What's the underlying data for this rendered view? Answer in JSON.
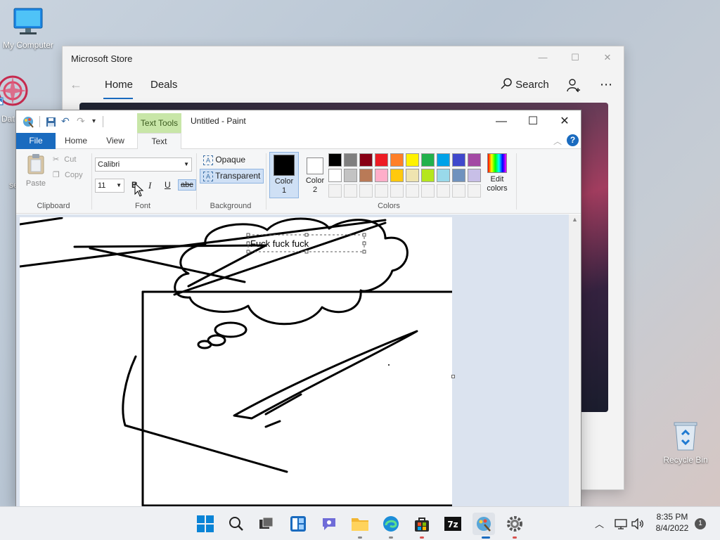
{
  "desktop": {
    "icons": [
      {
        "label": "My Computer"
      },
      {
        "label": "Dat"
      },
      {
        "label": "se"
      },
      {
        "label": "Recycle Bin"
      }
    ]
  },
  "store": {
    "title": "Microsoft Store",
    "nav": {
      "home": "Home",
      "deals": "Deals",
      "search": "Search"
    },
    "controls": {
      "minimize": "—",
      "maximize": "☐",
      "close": "✕"
    }
  },
  "paint": {
    "contextual_tab": "Text Tools",
    "window_title": "Untitled - Paint",
    "tabs": {
      "file": "File",
      "home": "Home",
      "view": "View",
      "text": "Text"
    },
    "clipboard": {
      "paste": "Paste",
      "cut": "Cut",
      "copy": "Copy",
      "group": "Clipboard"
    },
    "font": {
      "family": "Calibri",
      "size": "11",
      "bold": "B",
      "italic": "I",
      "underline": "U",
      "strike": "abc",
      "group": "Font"
    },
    "background": {
      "opaque": "Opaque",
      "transparent": "Transparent",
      "group": "Background"
    },
    "colors": {
      "color1": "Color 1",
      "color2": "Color 2",
      "edit": "Edit colors",
      "group": "Colors",
      "row1": [
        "#000000",
        "#7f7f7f",
        "#880015",
        "#ed1c24",
        "#ff7f27",
        "#fff200",
        "#22b14c",
        "#00a2e8",
        "#3f48cc",
        "#a349a4"
      ],
      "row2": [
        "#ffffff",
        "#c3c3c3",
        "#b97a57",
        "#ffaec9",
        "#ffc90e",
        "#efe4b0",
        "#b5e61d",
        "#99d9ea",
        "#7092be",
        "#c8bfe7"
      ]
    },
    "canvas_text": "Fuck fuck fuck"
  },
  "taskbar": {
    "time": "8:35 PM",
    "date": "8/4/2022",
    "notifications": "1"
  }
}
